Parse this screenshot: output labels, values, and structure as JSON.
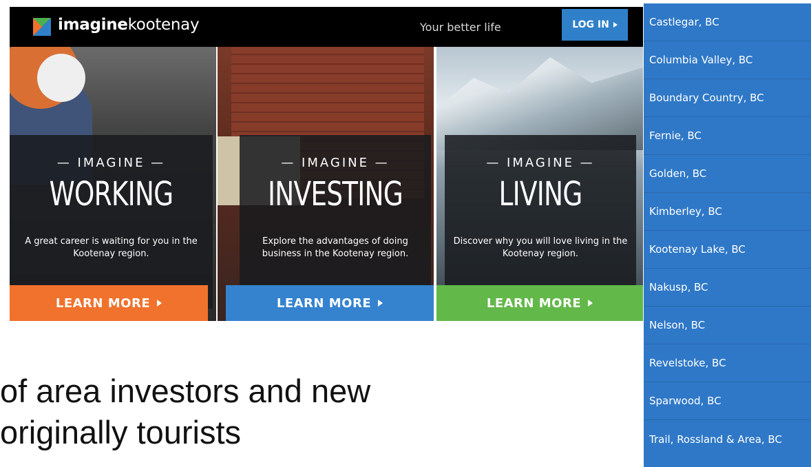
{
  "header": {
    "brand_bold": "imagine",
    "brand_rest": "kootenay",
    "tagline": "Your better life",
    "login_label": "LOG IN"
  },
  "panels": [
    {
      "kicker": "— IMAGINE —",
      "title": "WORKING",
      "description": "A great career is waiting for you in the Kootenay region.",
      "cta": "LEARN MORE",
      "cta_color": "#f0722d"
    },
    {
      "kicker": "— IMAGINE —",
      "title": "INVESTING",
      "description": "Explore the advantages of doing business in the Kootenay region.",
      "cta": "LEARN MORE",
      "cta_color": "#3583cf"
    },
    {
      "kicker": "— IMAGINE —",
      "title": "LIVING",
      "description": "Discover why you will love living in the Kootenay region.",
      "cta": "LEARN MORE",
      "cta_color": "#63b84a"
    }
  ],
  "slide_text": {
    "line1": "of area investors and new",
    "line2": "originally tourists"
  },
  "sidebar": {
    "items": [
      "Castlegar, BC",
      "Columbia Valley, BC",
      "Boundary Country, BC",
      "Fernie, BC",
      "Golden, BC",
      "Kimberley, BC",
      "Kootenay Lake, BC",
      "Nakusp, BC",
      "Nelson, BC",
      "Revelstoke, BC",
      "Sparwood, BC",
      "Trail, Rossland & Area, BC"
    ],
    "color": "#2f78c7"
  }
}
